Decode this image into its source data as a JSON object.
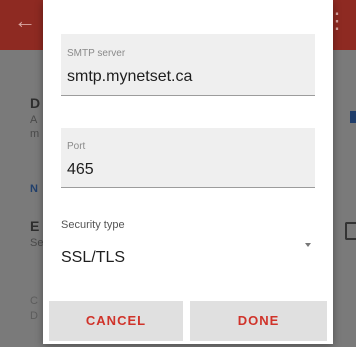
{
  "background": {
    "line1": "D",
    "line2": "A",
    "line3": "m",
    "section": "N",
    "line4": "E",
    "line5": "Se",
    "line6": "C",
    "line7": "D"
  },
  "dialog": {
    "smtp_server": {
      "label": "SMTP server",
      "value": "smtp.mynetset.ca"
    },
    "port": {
      "label": "Port",
      "value": "465"
    },
    "security_type": {
      "label": "Security type",
      "selected": "SSL/TLS"
    },
    "cancel_label": "CANCEL",
    "done_label": "DONE"
  },
  "colors": {
    "accent": "#d0332a",
    "app_bar": "#8e2a22",
    "field_bg": "#efefef",
    "button_bg": "#e0e0e0"
  },
  "icons": {
    "back": "arrow-back-icon",
    "overflow": "overflow-menu-icon",
    "dropdown": "dropdown-caret-icon"
  }
}
